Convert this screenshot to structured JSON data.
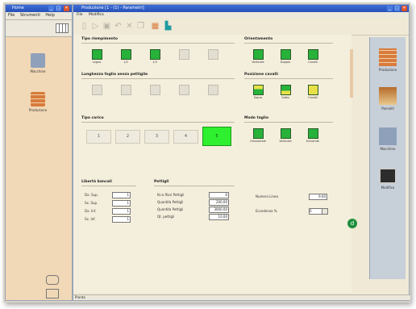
{
  "left_window": {
    "title": "Home",
    "menu": [
      "File",
      "Strumenti",
      "Help"
    ],
    "items": [
      {
        "label": "Macchine",
        "icon": "tool-icon"
      },
      {
        "label": "Produzione",
        "icon": "wall-icon"
      }
    ]
  },
  "main_window": {
    "title": "Produzione [1 - (1) - Parametri]",
    "menu": [
      "File",
      "Modifica"
    ],
    "sections": {
      "tipo_riempimento": "Tipo riempimento",
      "lunghezza_foglio": "Lunghezza foglio senza pettiglie",
      "tipo_carico": "Tipo carico",
      "orientamento": "Orientamento",
      "posizione_cavalli": "Posizione cavalli",
      "modo_taglio": "Modo taglio",
      "liberta_bancali": "Libertà bancali",
      "pettigli": "Pettigli"
    },
    "riempimento_buttons": [
      {
        "label": "Legno",
        "enabled": true
      },
      {
        "label": "1/2",
        "enabled": true
      },
      {
        "label": "1/3",
        "enabled": true
      },
      {
        "label": "",
        "enabled": false
      },
      {
        "label": "",
        "enabled": false
      }
    ],
    "lunghezza_buttons": [
      "",
      "",
      "",
      "",
      ""
    ],
    "carico_values": [
      "1",
      "2",
      "3",
      "4",
      "5"
    ],
    "carico_selected": "5",
    "orientamento_buttons": [
      "Verticale",
      "Doppio",
      "Cavalli"
    ],
    "cavalli_buttons": [
      "Sopra",
      "Sotto",
      "Cavalli"
    ],
    "taglio_buttons": [
      "Orizzontale",
      "Verticale",
      "Entrambi"
    ],
    "bancali_fields": [
      {
        "label": "Dx. Sup.",
        "value": "1"
      },
      {
        "label": "Sx. Sup.",
        "value": "1"
      },
      {
        "label": "Dx. Inf.",
        "value": "1"
      },
      {
        "label": "Sx. Inf.",
        "value": "1"
      }
    ],
    "pettigli_fields": [
      {
        "label": "N.ro  filari Pettigli",
        "value": "6"
      },
      {
        "label": "Quantità Pettigli",
        "value": "200.00"
      },
      {
        "label": "Quantità Pettigli",
        "value": "3000.00"
      },
      {
        "label": "Qt. pettigli",
        "value": "10.00"
      }
    ],
    "right_fields": [
      {
        "label": "Numero Linea",
        "value": "9.00"
      },
      {
        "label": "Eccedenza %",
        "value": "0"
      }
    ],
    "status_text": "Pronto"
  },
  "right_panel": {
    "items": [
      "Produzione",
      "Pannelli",
      "Macchine",
      "Modifica"
    ]
  },
  "colors": {
    "accent_green": "#27b23a",
    "title_blue": "#2a5fd0"
  }
}
